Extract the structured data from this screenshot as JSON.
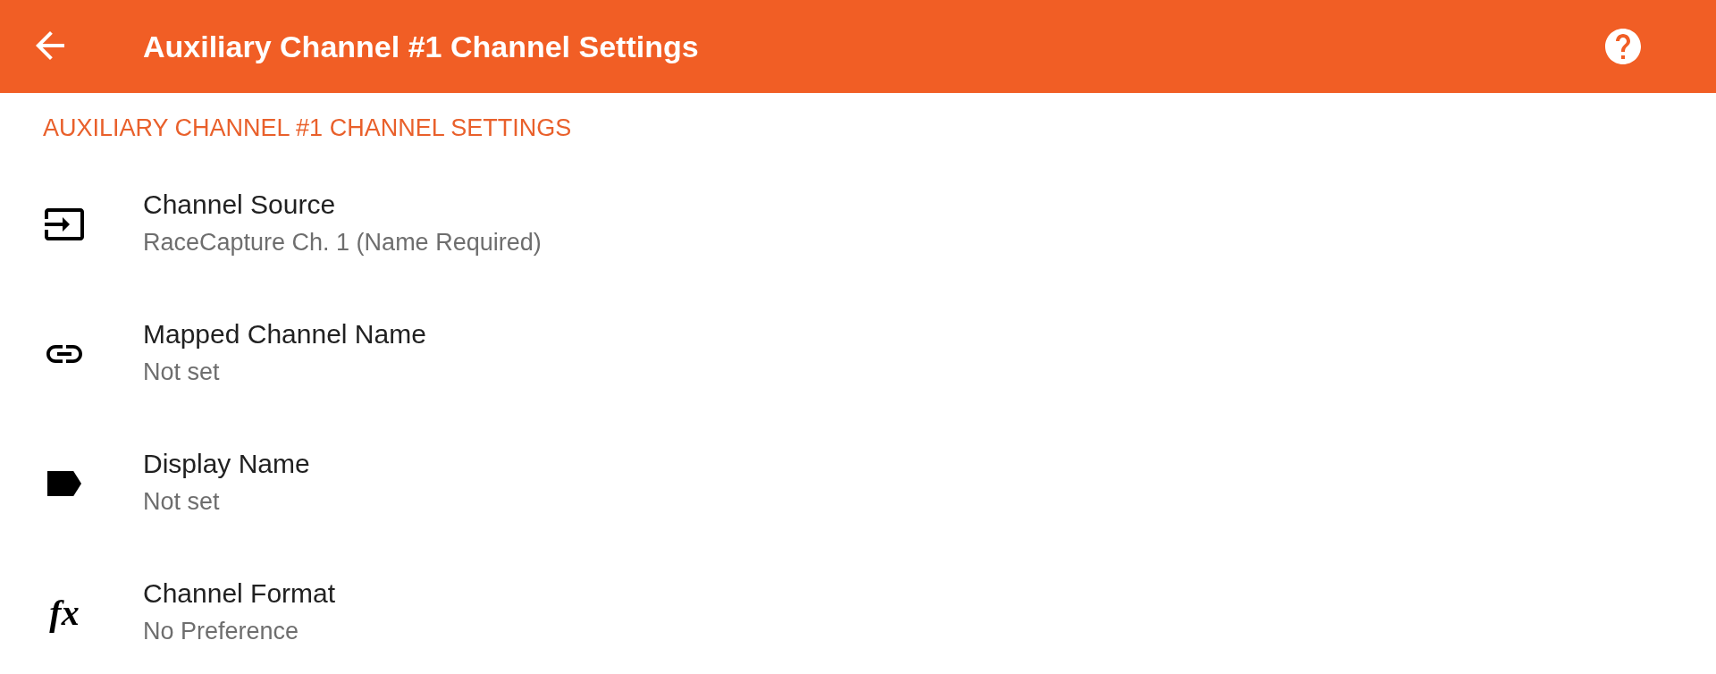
{
  "app_bar": {
    "title": "Auxiliary Channel #1 Channel Settings"
  },
  "section": {
    "title": "AUXILIARY CHANNEL #1 CHANNEL SETTINGS"
  },
  "rows": [
    {
      "title": "Channel Source",
      "value": "RaceCapture Ch. 1 (Name Required)"
    },
    {
      "title": "Mapped Channel Name",
      "value": "Not set"
    },
    {
      "title": "Display Name",
      "value": "Not set"
    },
    {
      "title": "Channel Format",
      "value": "No Preference",
      "icon_text": "fx"
    }
  ]
}
